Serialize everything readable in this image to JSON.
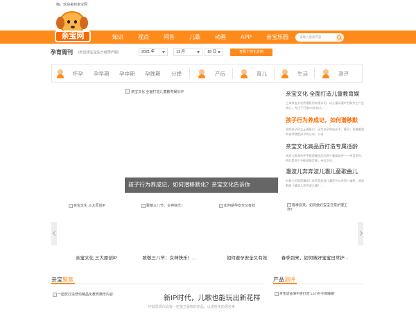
{
  "topbar": {
    "welcome": "嗨，欢迎来到亲宝网"
  },
  "logo": {
    "text": "亲宝网"
  },
  "nav": {
    "items": [
      "知识",
      "视点",
      "问答",
      "儿歌",
      "动画",
      "APP",
      "亲宝乐园"
    ],
    "search_placeholder": "请输入搜索内容"
  },
  "weekly": {
    "title": "孕育周刊",
    "hint": "(秒选择宝宝生日或预产期)",
    "year": "2021 年",
    "month": "11 月",
    "day": "18 日",
    "button": "查看个性化定制"
  },
  "categories": {
    "pregnancy": [
      "怀孕",
      "孕早期",
      "孕中期",
      "孕晚期",
      "分娩"
    ],
    "postpartum": "产后",
    "parenting": "育儿",
    "life": "生活",
    "review": "测评"
  },
  "slider": {
    "image_alt": "亲宝文化 全面打造儿童教育娱乐IP",
    "caption": "孩子行为养成记，如何潜移默化？亲宝文化告诉你"
  },
  "news": [
    {
      "title": "亲宝文化 全面打造儿童教育娱",
      "desc": "上海亲宝文化传播股份有限公司，以儿童动漫IP形象为主产品核心，专注于打造0-6岁幼儿..."
    },
    {
      "title": "孩子行为养成记，如何潜移默",
      "desc": "帮助孩子树立正确意识，因为孩子的成长中，最早，也最重要的老师就是孩子的父母，父母..."
    },
    {
      "title": "亲宝文化高品质打造专属适龄",
      "desc": "该织儿歌演示中不能遗漏当后的两个重要组件——多音多利，他们是两个不能省略步骤，亲宝文化..."
    },
    {
      "title": "灞波儿奔奔波儿灞儿童歌曲儿",
      "desc": "科普上的我是灞波儿奔他是奔波儿灞是什么东西？幽默，波波歌曲《灞波儿奔奔波儿灞》..."
    }
  ],
  "gallery": [
    {
      "image_alt": "亲宝文化 三大原创IP",
      "label": "亲宝文化 三大原创IP"
    },
    {
      "image_alt": "致敬三八节：女神快乐！",
      "label": "致敬三八节：女神快乐！..."
    },
    {
      "image_alt": "如何避孕安全又有效",
      "label": "如何避孕安全又有效"
    },
    {
      "image_alt": "春季到来，如何做好宝宝日常护理工作？",
      "label": "春季到来，如何做好宝宝日常护..."
    }
  ],
  "sections": {
    "focus": {
      "a": "亲宝",
      "b": "聚焦"
    },
    "review": {
      "a": "产品",
      "b": "测评"
    }
  },
  "feature": {
    "image_alt": "一起武打造低幼精品化教育娱乐内容",
    "title": "新IP时代，儿歌也能玩出新花样",
    "desc": "IP就是现代具有一定独立版权的作品，以通俗化的语言来"
  },
  "review_item": {
    "image_alt": "亲宝适益薄干爽打造“12小时干爽睡眠”"
  },
  "colors": {
    "accent": "#ff8a1c",
    "highlight": "#ff6a00"
  }
}
